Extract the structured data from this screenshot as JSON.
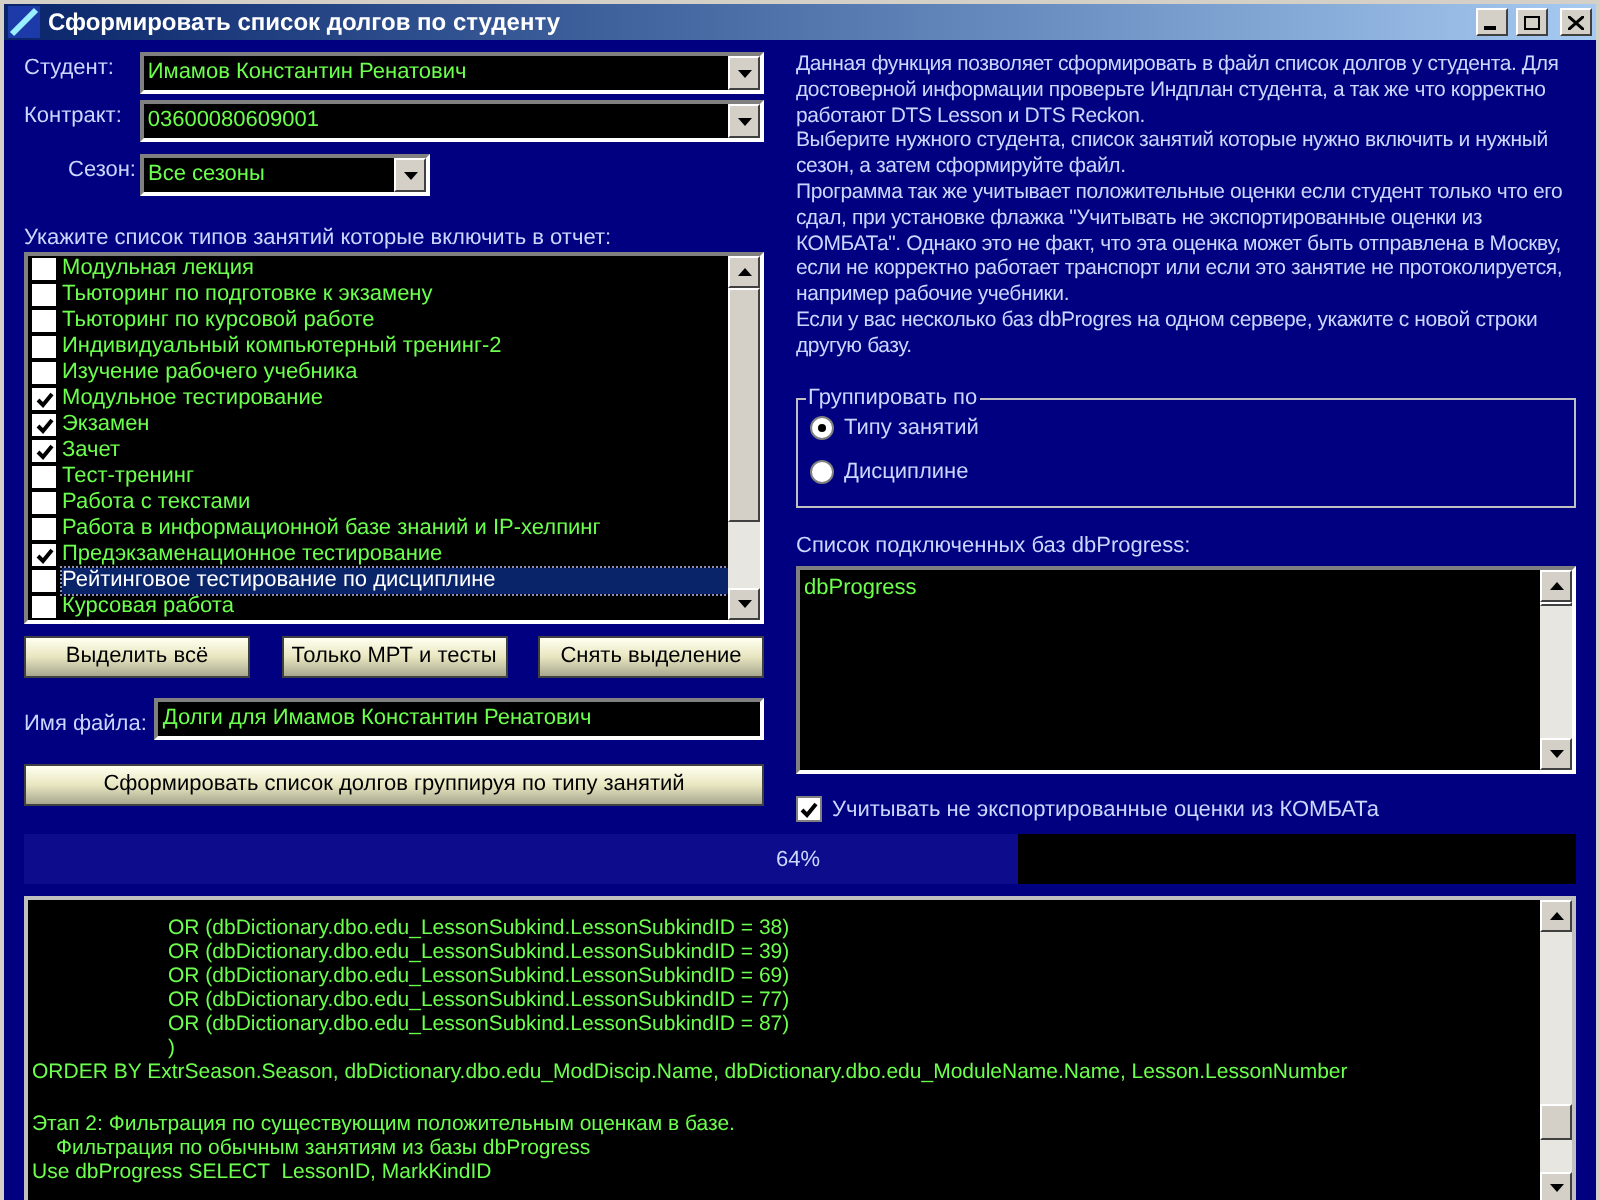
{
  "window": {
    "title": "Сформировать список долгов по студенту"
  },
  "student": {
    "label": "Студент:",
    "value": "Имамов Константин Ренатович"
  },
  "contract": {
    "label": "Контракт:",
    "value": "03600080609001"
  },
  "season": {
    "label": "Сезон:",
    "value": "Все сезоны"
  },
  "lesson_types": {
    "label": "Укажите список типов занятий которые включить в отчет:",
    "items": [
      {
        "label": "Модульная лекция",
        "checked": false,
        "selected": false
      },
      {
        "label": "Тьюторинг по подготовке к экзамену",
        "checked": false,
        "selected": false
      },
      {
        "label": "Тьюторинг  по курсовой работе",
        "checked": false,
        "selected": false
      },
      {
        "label": "Индивидуальный компьютерный тренинг-2",
        "checked": false,
        "selected": false
      },
      {
        "label": "Изучение рабочего учебника",
        "checked": false,
        "selected": false
      },
      {
        "label": "Модульное тестирование",
        "checked": true,
        "selected": false
      },
      {
        "label": "Экзамен",
        "checked": true,
        "selected": false
      },
      {
        "label": "Зачет",
        "checked": true,
        "selected": false
      },
      {
        "label": "Тест-тренинг",
        "checked": false,
        "selected": false
      },
      {
        "label": "Работа с текстами",
        "checked": false,
        "selected": false
      },
      {
        "label": "Работа в информационной базе знаний и IP-хелпинг",
        "checked": false,
        "selected": false
      },
      {
        "label": "Предэкзаменационное тестирование",
        "checked": true,
        "selected": false
      },
      {
        "label": "Рейтинговое тестирование по дисциплине",
        "checked": false,
        "selected": true
      },
      {
        "label": "Курсовая работа",
        "checked": false,
        "selected": false
      }
    ]
  },
  "selection_buttons": [
    "Выделить всё",
    "Только МРТ и тесты",
    "Снять выделение"
  ],
  "file_name": {
    "label": "Имя файла:",
    "value": "Долги для Имамов Константин Ренатович"
  },
  "generate_button": "Сформировать список долгов группируя по типу занятий",
  "description": [
    "Данная функция позволяет сформировать в файл список долгов у студента. Для достоверной информации проверьте Индплан студента, а так же что корректно работают DTS Lesson и DTS Reckon.",
    "Выберите нужного студента, список занятий которые нужно включить и нужный сезон, а затем сформируйте файл.",
    "Программа так же учитывает положительные оценки если студент только что его сдал, при установке флажка \"Учитывать не экспортированные оценки из КОМБАТа\". Однако это не факт, что эта оценка может быть отправлена в Москву, если не корректно работает транспорт или если это занятие не протоколируется, например рабочие учебники.",
    "Если у вас несколько баз dbProgres на одном сервере, укажите с новой строки другую базу."
  ],
  "group_by": {
    "title": "Группировать по",
    "options": [
      {
        "label": "Типу занятий",
        "selected": true
      },
      {
        "label": "Дисциплине",
        "selected": false
      }
    ]
  },
  "databases": {
    "label": "Список подключенных баз dbProgress:",
    "items": [
      "dbProgress"
    ]
  },
  "include_unexported": {
    "label": "Учитывать не экспортированные оценки из КОМБАТа",
    "checked": true
  },
  "progress": {
    "level": 0.64,
    "reading": "64%"
  },
  "log": [
    {
      "kind": "cond",
      "text": "OR (dbDictionary.dbo.edu_LessonSubkind.LessonSubkindID = 38)"
    },
    {
      "kind": "cond",
      "text": "OR (dbDictionary.dbo.edu_LessonSubkind.LessonSubkindID = 39)"
    },
    {
      "kind": "cond",
      "text": "OR (dbDictionary.dbo.edu_LessonSubkind.LessonSubkindID = 69)"
    },
    {
      "kind": "cond",
      "text": "OR (dbDictionary.dbo.edu_LessonSubkind.LessonSubkindID = 77)"
    },
    {
      "kind": "cond",
      "text": "OR (dbDictionary.dbo.edu_LessonSubkind.LessonSubkindID = 87)"
    },
    {
      "kind": "cond",
      "text": ")"
    },
    {
      "kind": "line",
      "text": "ORDER BY ExtrSeason.Season, dbDictionary.dbo.edu_ModDiscip.Name, dbDictionary.dbo.edu_ModuleName.Name, Lesson.LessonNumber"
    },
    {
      "kind": "step",
      "text": "Этап 2: Фильтрация по существующим положительным оценкам в базе."
    },
    {
      "kind": "sub",
      "text": "Фильтрация по обычным занятиям из базы dbProgress"
    },
    {
      "kind": "line",
      "text": "Use dbProgress SELECT  LessonID, MarkKindID"
    }
  ]
}
